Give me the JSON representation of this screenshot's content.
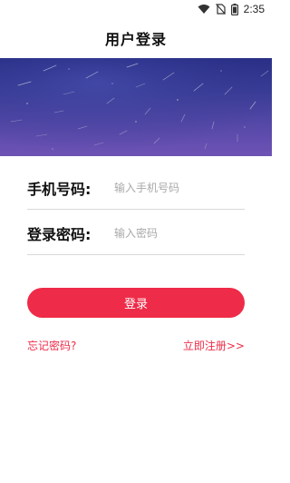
{
  "status_bar": {
    "time": "2:35",
    "icons": [
      "wifi-icon",
      "no-sim-icon",
      "battery-icon"
    ]
  },
  "header": {
    "title": "用户登录"
  },
  "banner": {
    "image": "starry-night-sky"
  },
  "form": {
    "phone": {
      "label": "手机号码:",
      "placeholder": "输入手机号码",
      "value": ""
    },
    "password": {
      "label": "登录密码:",
      "placeholder": "输入密码",
      "value": ""
    },
    "login_label": "登录"
  },
  "links": {
    "forgot": "忘记密码?",
    "register": "立即注册>>"
  },
  "colors": {
    "accent": "#ee2b48",
    "banner_top": "#2a2f86",
    "banner_bottom": "#6e53b5"
  }
}
